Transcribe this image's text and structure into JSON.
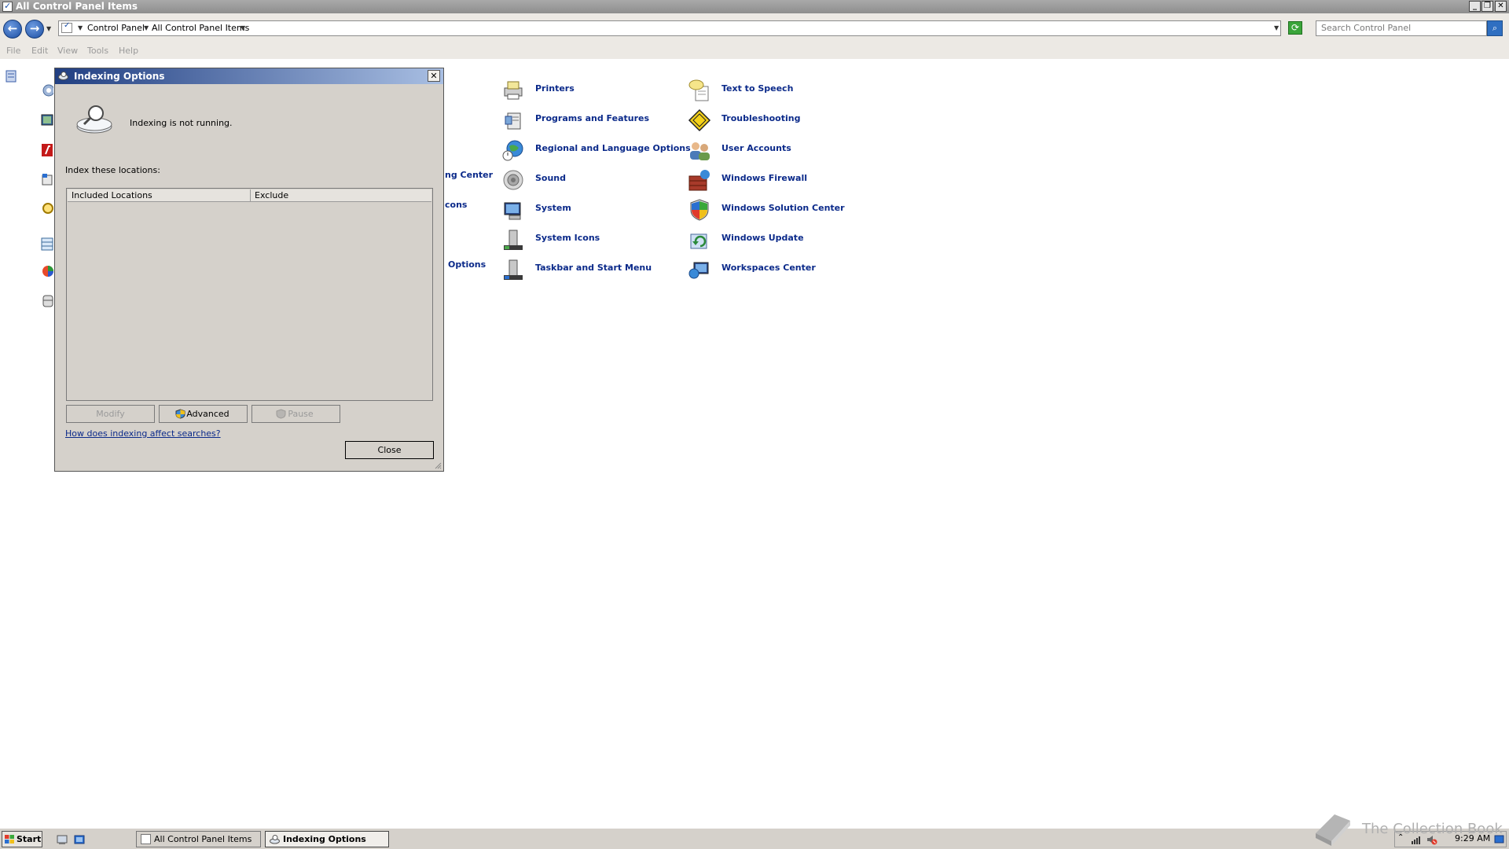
{
  "window": {
    "title": "All Control Panel Items"
  },
  "address": {
    "crumbs": [
      "Control Panel",
      "All Control Panel Items"
    ],
    "search_placeholder": "Search Control Panel"
  },
  "menu": [
    "File",
    "Edit",
    "View",
    "Tools",
    "Help"
  ],
  "items_col1": [
    {
      "label": "Printers",
      "icon": "printer-icon"
    },
    {
      "label": "Programs and Features",
      "icon": "programs-icon"
    },
    {
      "label": "Regional and Language Options",
      "icon": "globe-clock-icon"
    },
    {
      "label": "Sound",
      "icon": "speaker-icon"
    },
    {
      "label": "System",
      "icon": "system-icon"
    },
    {
      "label": "System Icons",
      "icon": "system-icons-icon"
    },
    {
      "label": "Taskbar and Start Menu",
      "icon": "taskbar-icon"
    }
  ],
  "items_col2": [
    {
      "label": "Text to Speech",
      "icon": "speech-icon"
    },
    {
      "label": "Troubleshooting",
      "icon": "troubleshoot-icon"
    },
    {
      "label": "User Accounts",
      "icon": "users-icon"
    },
    {
      "label": "Windows Firewall",
      "icon": "firewall-icon"
    },
    {
      "label": "Windows Solution Center",
      "icon": "shield-icon"
    },
    {
      "label": "Windows Update",
      "icon": "update-icon"
    },
    {
      "label": "Workspaces Center",
      "icon": "workspaces-icon"
    }
  ],
  "partial_items": [
    "ng Center",
    "cons",
    "Options"
  ],
  "dialog": {
    "title": "Indexing Options",
    "status": "Indexing is not running.",
    "index_label": "Index these locations:",
    "col_included": "Included Locations",
    "col_exclude": "Exclude",
    "btn_modify": "Modify",
    "btn_advanced": "Advanced",
    "btn_pause": "Pause",
    "help_link": "How does indexing affect searches?",
    "btn_close": "Close"
  },
  "taskbar": {
    "start": "Start",
    "tasks": [
      "All Control Panel Items",
      "Indexing Options"
    ],
    "clock": "9:29 AM"
  },
  "watermark": "The Collection Book",
  "colors": {
    "link": "#0b2a8a",
    "dialog_bg": "#d5d1cb",
    "title_gradient_start": "#213f82"
  }
}
